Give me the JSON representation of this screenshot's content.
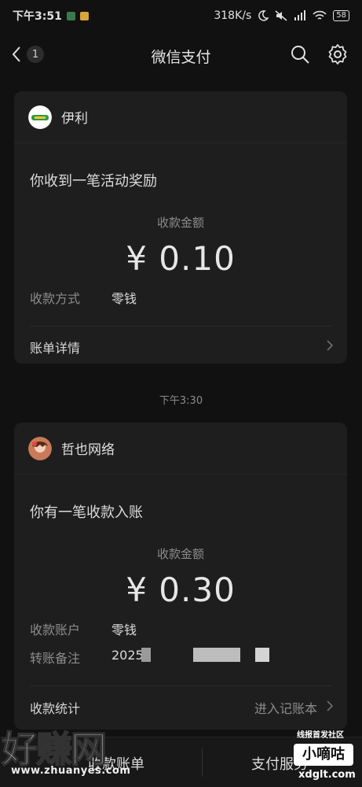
{
  "status_bar": {
    "time": "下午3:51",
    "network_speed": "318K/s",
    "signal": "ᴴᴰ",
    "battery": "58"
  },
  "nav": {
    "title": "微信支付",
    "back_count": "1",
    "icons": [
      "back-arrow-icon",
      "search-icon",
      "gear-icon"
    ]
  },
  "messages": [
    {
      "merchant": "伊利",
      "title": "你收到一笔活动奖励",
      "amount_label": "收款金额",
      "amount": "¥ 0.10",
      "rows": [
        {
          "label": "收款方式",
          "value": "零钱"
        }
      ],
      "footer": {
        "label": "账单详情",
        "right": ""
      }
    },
    {
      "merchant": "哲也网络",
      "title": "你有一笔收款入账",
      "amount_label": "收款金额",
      "amount": "¥ 0.30",
      "rows": [
        {
          "label": "收款账户",
          "value": "零钱"
        },
        {
          "label": "转账备注",
          "value": "2025"
        }
      ],
      "footer": {
        "label": "收款统计",
        "right": "进入记账本"
      }
    }
  ],
  "timestamp": "下午3:30",
  "bottom_bar": {
    "left": "收款账单",
    "right": "支付服务"
  },
  "watermarks": {
    "left_main": "好赚网",
    "left_sub": "www.zhuanyes.com",
    "right_top": "线报首发社区",
    "right_box": "小嘀咕",
    "right_sub": "xdglt.com"
  },
  "colors": {
    "background": "#111111",
    "card": "#1e1e1e",
    "secondary_text": "#8c8c8c"
  }
}
